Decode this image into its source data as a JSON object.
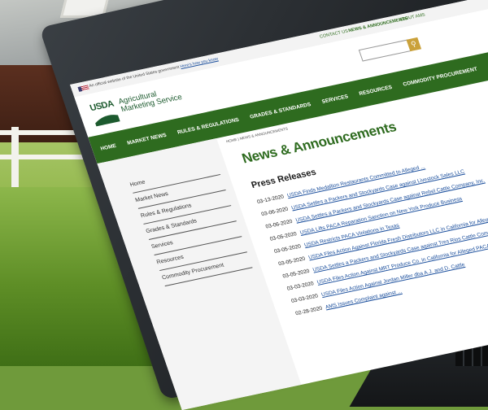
{
  "gov_banner": {
    "text": "An official website of the United States government",
    "link": "Here's how you know"
  },
  "utility_links": {
    "contact": "CONTACT US",
    "news": "NEWS & ANNOUNCEMENTS",
    "about": "ABOUT AMS"
  },
  "logo": {
    "mark": "USDA",
    "name": "Agricultural Marketing Service"
  },
  "nav": {
    "items": [
      "HOME",
      "MARKET NEWS",
      "RULES & REGULATIONS",
      "GRADES & STANDARDS",
      "SERVICES",
      "RESOURCES",
      "COMMODITY PROCUREMENT"
    ]
  },
  "breadcrumb": "HOME | NEWS & ANNOUNCEMENTS",
  "sidebar": {
    "items": [
      "Home",
      "Market News",
      "Rules & Regulations",
      "Grades & Standards",
      "Services",
      "Resources",
      "Commodity Procurement"
    ]
  },
  "main": {
    "title": "News & Announcements",
    "section": "Press Releases",
    "releases": [
      {
        "date": "03-13-2020",
        "title": "USDA Finds Medallion Restaurants Committed to Alleged ..."
      },
      {
        "date": "03-06-2020",
        "title": "USDA Settles a Packers and Stockyards Case against Livestock Sales LLC"
      },
      {
        "date": "03-06-2020",
        "title": "USDA Settles a Packers and Stockyards Case against Rebel Cattle Company, Inc."
      },
      {
        "date": "03-05-2020",
        "title": "USDA Lifts PACA Reparation Sanction on New York Produce Business"
      },
      {
        "date": "03-05-2020",
        "title": "USDA Restricts PACA Violations in Texas"
      },
      {
        "date": "03-05-2020",
        "title": "USDA Files Action Against Florida Fresh Distributors LLC in California for Alleged PACA Violations"
      },
      {
        "date": "03-05-2020",
        "title": "USDA Settles a Packers and Stockyards Case against Tres Rios Cattle Company LLC"
      },
      {
        "date": "03-03-2020",
        "title": "USDA Files Action Against MRT Produce Co. in California for Alleged PACA Violations"
      },
      {
        "date": "03-03-2020",
        "title": "USDA Files Action Against Jordan Miller dba A.J. and D. Cattle"
      },
      {
        "date": "02-28-2020",
        "title": "AMS Issues Complaint against ..."
      }
    ]
  },
  "colors": {
    "nav_green": "#2e6b1f",
    "link_blue": "#1a4e9c",
    "title_green": "#2e6b1f",
    "search_gold": "#caa13a"
  }
}
